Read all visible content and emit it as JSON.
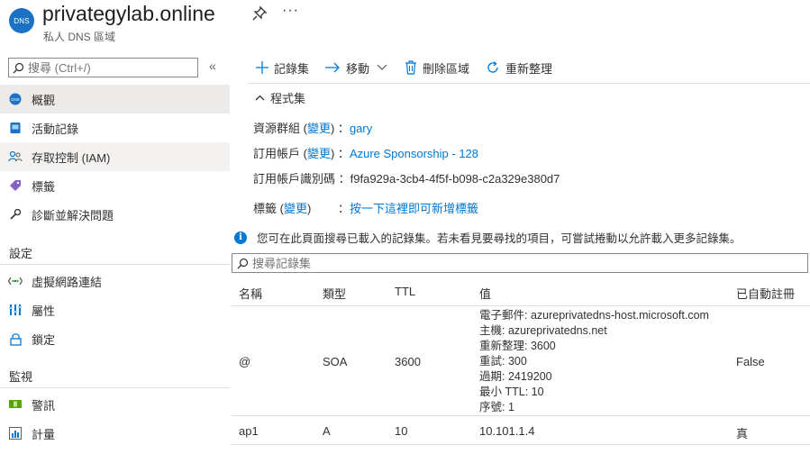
{
  "header": {
    "icon_text": "DNS",
    "title": "privategylab.online",
    "subtitle": "私人 DNS 區域",
    "more_label": "···"
  },
  "sidebar": {
    "search_placeholder": "搜尋 (Ctrl+/)",
    "collapse_label": "«",
    "items": [
      {
        "label": "概觀",
        "icon": "overview-icon"
      },
      {
        "label": "活動記錄",
        "icon": "activity-log-icon"
      },
      {
        "label": "存取控制 (IAM)",
        "icon": "iam-icon"
      },
      {
        "label": "標籤",
        "icon": "tag-icon"
      },
      {
        "label": "診斷並解決問題",
        "icon": "wrench-icon"
      }
    ],
    "settings_title": "設定",
    "settings_items": [
      {
        "label": "虛擬網路連結",
        "icon": "vnet-link-icon"
      },
      {
        "label": "屬性",
        "icon": "properties-icon"
      },
      {
        "label": "鎖定",
        "icon": "lock-icon"
      }
    ],
    "monitor_title": "監視",
    "monitor_items": [
      {
        "label": "警訊",
        "icon": "alerts-icon"
      },
      {
        "label": "計量",
        "icon": "metrics-icon"
      }
    ]
  },
  "toolbar": {
    "add_label": "記錄集",
    "move_label": "移動",
    "delete_label": "刪除區域",
    "refresh_label": "重新整理"
  },
  "essentials": {
    "title": "程式集",
    "resource_group_label": "資源群組",
    "change_label": "變更",
    "resource_group_value": "gary",
    "subscription_label": "訂用帳戶",
    "subscription_value": "Azure Sponsorship - 128",
    "subscription_id_label": "訂用帳戶識別碼",
    "subscription_id_value": "f9fa929a-3cb4-4f5f-b098-c2a329e380d7",
    "tags_label": "標籤",
    "tags_value": "按一下這裡即可新增標籤"
  },
  "info_text": "您可在此頁面搜尋已載入的記錄集。若未看見要尋找的項目，可嘗試捲動以允許載入更多記錄集。",
  "record_search_placeholder": "搜尋記錄集",
  "table": {
    "headers": [
      "名稱",
      "類型",
      "TTL",
      "值",
      "已自動註冊"
    ],
    "rows": [
      {
        "name": "@",
        "type": "SOA",
        "ttl": "3600",
        "value_lines": [
          "電子郵件: azureprivatedns-host.microsoft.com",
          "主機: azureprivatedns.net",
          "重新整理: 3600",
          "重試: 300",
          "過期: 2419200",
          "最小 TTL: 10",
          "序號: 1"
        ],
        "auto": "False"
      },
      {
        "name": "ap1",
        "type": "A",
        "ttl": "10",
        "value_lines": [
          "10.101.1.4"
        ],
        "auto": "真"
      }
    ]
  },
  "colors": {
    "accent": "#0078d4",
    "selected_bg": "#edebe9"
  }
}
